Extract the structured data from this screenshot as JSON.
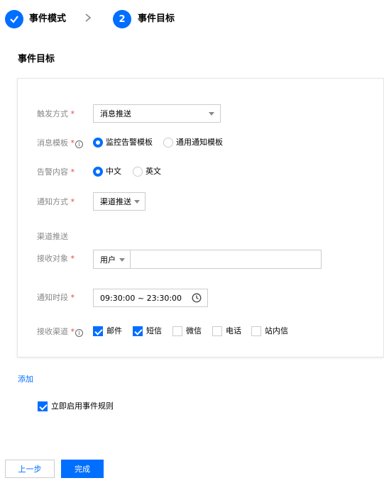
{
  "steps": {
    "step1_label": "事件模式",
    "step2_number": "2",
    "step2_label": "事件目标"
  },
  "section": {
    "title": "事件目标"
  },
  "form": {
    "trigger": {
      "label": "触发方式",
      "value": "消息推送"
    },
    "template": {
      "label": "消息模板",
      "options": [
        "监控告警模板",
        "通用通知模板"
      ],
      "selected": "监控告警模板"
    },
    "content": {
      "label": "告警内容",
      "options": [
        "中文",
        "英文"
      ],
      "selected": "中文"
    },
    "notify_method": {
      "label": "通知方式",
      "value": "渠道推送"
    },
    "channel_section_title": "渠道推送",
    "receiver": {
      "label": "接收对象",
      "type_value": "用户",
      "value": ""
    },
    "period": {
      "label": "通知时段",
      "value": "09:30:00 ~ 23:30:00"
    },
    "channels": {
      "label": "接收渠道",
      "items": [
        {
          "label": "邮件",
          "checked": true
        },
        {
          "label": "短信",
          "checked": true
        },
        {
          "label": "微信",
          "checked": false
        },
        {
          "label": "电话",
          "checked": false
        },
        {
          "label": "站内信",
          "checked": false
        }
      ]
    }
  },
  "add_link": "添加",
  "enable_rule": {
    "label": "立即启用事件规则",
    "checked": true
  },
  "buttons": {
    "prev": "上一步",
    "done": "完成"
  },
  "colors": {
    "accent": "#006eff",
    "required": "#e54545"
  }
}
